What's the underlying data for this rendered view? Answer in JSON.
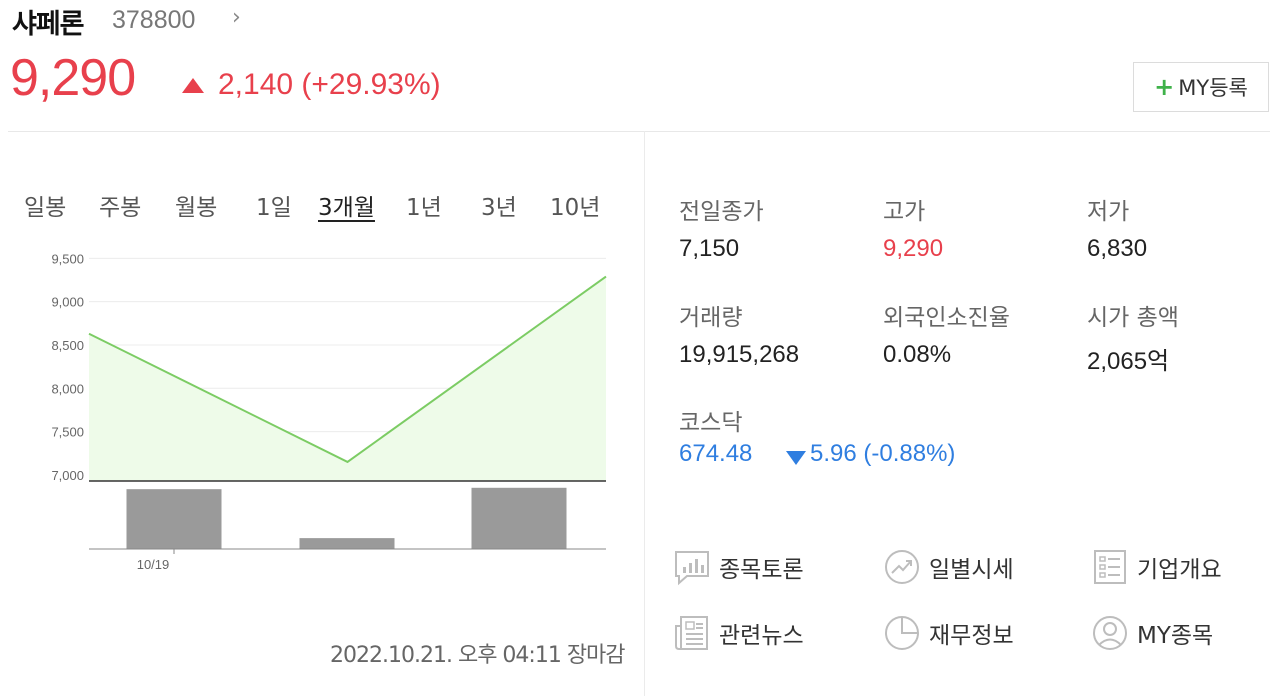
{
  "stock": {
    "name": "샤페론",
    "code": "378800",
    "price": "9,290",
    "change": "2,140 (+29.93%)",
    "my_register": "MY등록"
  },
  "tabs": [
    {
      "label": "일봉"
    },
    {
      "label": "주봉"
    },
    {
      "label": "월봉"
    },
    {
      "label": "1일"
    },
    {
      "label": "3개월"
    },
    {
      "label": "1년"
    },
    {
      "label": "3년"
    },
    {
      "label": "10년"
    }
  ],
  "active_tab": "3개월",
  "chart_data": {
    "type": "line",
    "y_tick_labels": [
      "9,500",
      "9,000",
      "8,500",
      "8,000",
      "7,500",
      "7,000"
    ],
    "ylim": [
      6930,
      9550
    ],
    "price_points": [
      {
        "x": 0,
        "y": 8630
      },
      {
        "x": 1,
        "y": 7150
      },
      {
        "x": 2,
        "y": 9290
      }
    ],
    "volume_bars_relative": [
      0.88,
      0.16,
      0.9
    ],
    "x_tick_labels": [
      "10/19"
    ],
    "line_color": "#7ccc64",
    "fill_color": "#eefbe9",
    "volume_color": "#9a9a9a"
  },
  "as_of": "2022.10.21. 오후 04:11 장마감",
  "stats": {
    "prev_close": {
      "label": "전일종가",
      "value": "7,150"
    },
    "high": {
      "label": "고가",
      "value": "9,290"
    },
    "low": {
      "label": "저가",
      "value": "6,830"
    },
    "volume": {
      "label": "거래량",
      "value": "19,915,268"
    },
    "foreign_ratio": {
      "label": "외국인소진율",
      "value": "0.08%"
    },
    "market_cap": {
      "label": "시가 총액",
      "value": "2,065억"
    }
  },
  "kosdaq": {
    "label": "코스닥",
    "value": "674.48",
    "change": "5.96 (-0.88%)"
  },
  "links": {
    "discussion": "종목토론",
    "daily_price": "일별시세",
    "company_info": "기업개요",
    "news": "관련뉴스",
    "financials": "재무정보",
    "my_stocks": "MY종목"
  },
  "colors": {
    "up": "#e8404c",
    "down": "#2f7ee0",
    "accent_green": "#3fb24a"
  }
}
